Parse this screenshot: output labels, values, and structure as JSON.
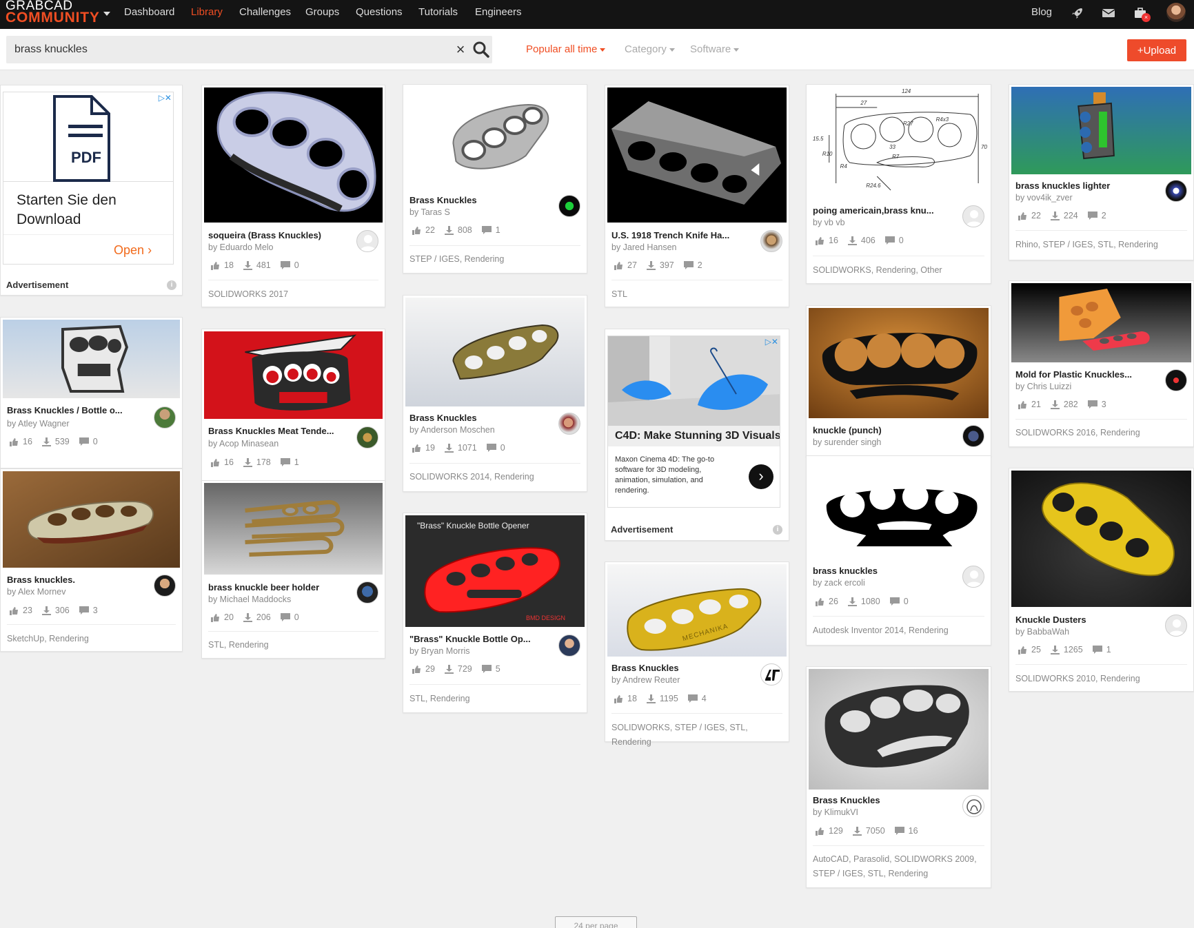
{
  "brand": {
    "line1": "GRABCAD",
    "line2": "COMMUNITY"
  },
  "nav": [
    "Dashboard",
    "Library",
    "Challenges",
    "Groups",
    "Questions",
    "Tutorials",
    "Engineers"
  ],
  "nav_active": "Library",
  "nav_right": {
    "blog": "Blog",
    "cart_badge": "×"
  },
  "search": {
    "value": "brass knuckles"
  },
  "filters": {
    "sort": "Popular all time",
    "category": "Category",
    "software": "Software"
  },
  "upload_label": "+Upload",
  "ads": [
    {
      "headline": "Starten Sie den Download",
      "icon_label": "PDF",
      "cta": "Open",
      "label": "Advertisement"
    },
    {
      "headline": "C4D: Make Stunning 3D Visuals",
      "body": "Maxon Cinema 4D: The go-to software for 3D modeling, animation, simulation, and rendering.",
      "label": "Advertisement"
    }
  ],
  "cards": [
    {
      "title": "soqueira (Brass Knuckles)",
      "author": "by Eduardo Melo",
      "likes": "18",
      "downloads": "481",
      "comments": "0",
      "tags": "SOLIDWORKS 2017"
    },
    {
      "title": "Brass Knuckles",
      "author": "by Taras S",
      "likes": "22",
      "downloads": "808",
      "comments": "1",
      "tags": "STEP / IGES, Rendering"
    },
    {
      "title": "U.S. 1918 Trench Knife Ha...",
      "author": "by Jared Hansen",
      "likes": "27",
      "downloads": "397",
      "comments": "2",
      "tags": "STL"
    },
    {
      "title": "poing americain,brass knu...",
      "author": "by vb vb",
      "likes": "16",
      "downloads": "406",
      "comments": "0",
      "tags": "SOLIDWORKS, Rendering, Other"
    },
    {
      "title": "brass knuckles lighter",
      "author": "by vov4ik_zver",
      "likes": "22",
      "downloads": "224",
      "comments": "2",
      "tags": "Rhino, STEP / IGES, STL, Rendering"
    },
    {
      "title": "Brass Knuckles / Bottle o...",
      "author": "by Atley Wagner",
      "likes": "16",
      "downloads": "539",
      "comments": "0",
      "tags": ""
    },
    {
      "title": "Brass Knuckles Meat Tende...",
      "author": "by Acop Minasean",
      "likes": "16",
      "downloads": "178",
      "comments": "1",
      "tags": ""
    },
    {
      "title": "Brass Knuckles",
      "author": "by Anderson Moschen",
      "likes": "19",
      "downloads": "1071",
      "comments": "0",
      "tags": "SOLIDWORKS 2014, Rendering"
    },
    {
      "title": "knuckle (punch)",
      "author": "by surender singh",
      "likes": "",
      "downloads": "",
      "comments": "",
      "tags": ""
    },
    {
      "title": "Mold for Plastic Knuckles...",
      "author": "by Chris Luizzi",
      "likes": "21",
      "downloads": "282",
      "comments": "3",
      "tags": "SOLIDWORKS 2016, Rendering"
    },
    {
      "title": "Brass knuckles.",
      "author": "by Alex Mornev",
      "likes": "23",
      "downloads": "306",
      "comments": "3",
      "tags": "SketchUp, Rendering"
    },
    {
      "title": "brass knuckle beer holder",
      "author": "by Michael Maddocks",
      "likes": "20",
      "downloads": "206",
      "comments": "0",
      "tags": "STL, Rendering"
    },
    {
      "title": "\"Brass\" Knuckle Bottle Op...",
      "author": "by Bryan Morris",
      "likes": "29",
      "downloads": "729",
      "comments": "5",
      "tags": "STL, Rendering",
      "thumb_caption": "\"Brass\" Knuckle Bottle Opener",
      "thumb_logo": "BMD DESIGN"
    },
    {
      "title": "brass knuckles",
      "author": "by zack ercoli",
      "likes": "26",
      "downloads": "1080",
      "comments": "0",
      "tags": "Autodesk Inventor 2014, Rendering"
    },
    {
      "title": "Knuckle Dusters",
      "author": "by BabbaWah",
      "likes": "25",
      "downloads": "1265",
      "comments": "1",
      "tags": "SOLIDWORKS 2010, Rendering"
    },
    {
      "title": "Brass Knuckles",
      "author": "by Andrew Reuter",
      "likes": "18",
      "downloads": "1195",
      "comments": "4",
      "tags": "SOLIDWORKS, STEP / IGES, STL, Rendering",
      "thumb_text": "MECHANIKA"
    },
    {
      "title": "Brass Knuckles",
      "author": "by KlimukVI",
      "likes": "129",
      "downloads": "7050",
      "comments": "16",
      "tags": "AutoCAD, Parasolid, SOLIDWORKS 2009, STEP / IGES, STL, Rendering"
    }
  ],
  "drawing_dims": [
    "124",
    "27",
    "R4x3",
    "R27",
    "33",
    "R7",
    "15.5",
    "R10",
    "R4",
    "70",
    "R24.6"
  ],
  "pager": "24 per page",
  "colors": {
    "accent": "#f04e23",
    "upload": "#ee4b2b",
    "topbar": "#141414"
  }
}
